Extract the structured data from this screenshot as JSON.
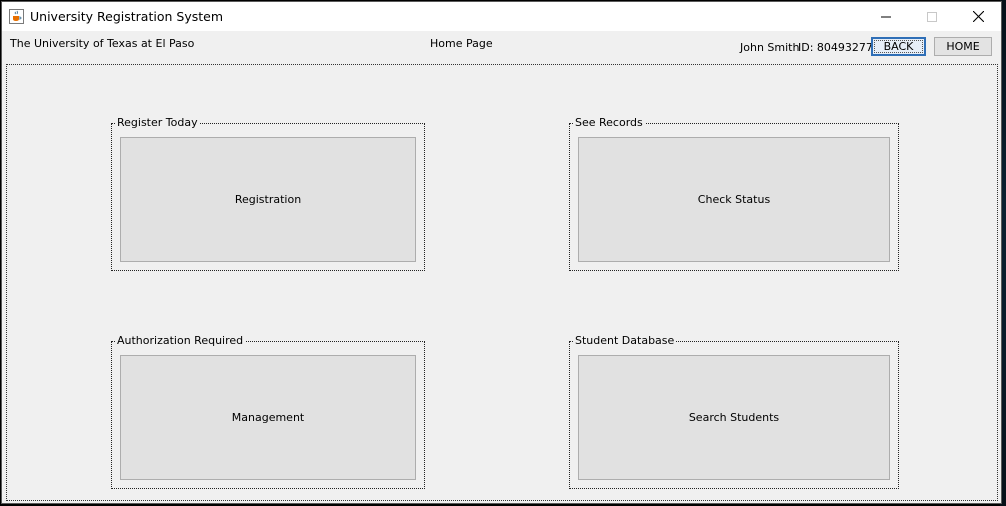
{
  "window": {
    "title": "University Registration System",
    "icon": "java-cup-icon"
  },
  "header": {
    "university": "The University of Texas at El Paso",
    "page_title": "Home Page",
    "user_name": "John Smith",
    "user_id": "ID: 80493277",
    "back_label": "BACK",
    "home_label": "HOME"
  },
  "panels": [
    {
      "title": "Register Today",
      "button": "Registration"
    },
    {
      "title": "See Records",
      "button": "Check Status"
    },
    {
      "title": "Authorization Required",
      "button": "Management"
    },
    {
      "title": "Student Database",
      "button": "Search Students"
    }
  ],
  "colors": {
    "window_bg": "#f0f0f0",
    "button_bg": "#e1e1e1",
    "focus_border": "#2f6fb7"
  }
}
